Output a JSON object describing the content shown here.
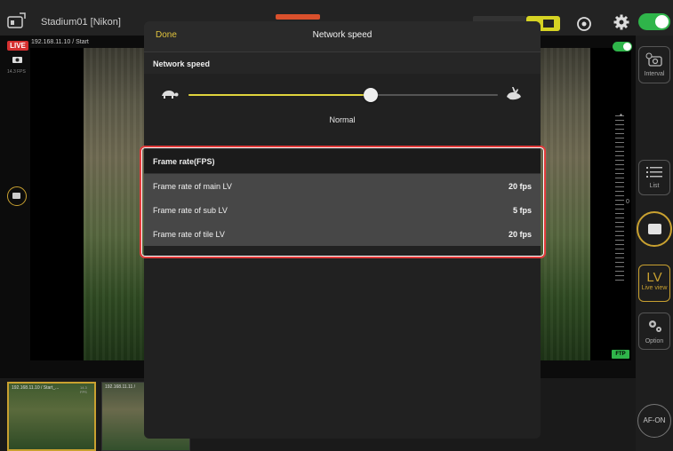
{
  "app": {
    "title": "Stadium01 [Nikon]"
  },
  "left_panel": {
    "live_badge": "LIVE",
    "ip_label": "192.168.11.10 / Start",
    "fps_label": "14.3 FPS"
  },
  "sidebar": {
    "interval_label": "Interval",
    "list_label": "List",
    "lv_text": "LV",
    "lv_label": "Live view",
    "option_label": "Option",
    "af_on_label": "AF-ON"
  },
  "overlay": {
    "ftp_badge": "FTP"
  },
  "thumbnails": [
    {
      "label": "192.168.11.10 / Start_...",
      "fps": "14.3 FPS"
    },
    {
      "label": "192.168.11.11 /",
      "fps": ""
    }
  ],
  "modal": {
    "done_label": "Done",
    "title": "Network speed",
    "network_section_label": "Network speed",
    "speed_value_label": "Normal",
    "speed_level": 0.59,
    "fps_section_label": "Frame rate(FPS)",
    "fps_rows": [
      {
        "name": "Frame rate of main LV",
        "value": "20 fps"
      },
      {
        "name": "Frame rate of sub LV",
        "value": "5 fps"
      },
      {
        "name": "Frame rate of tile LV",
        "value": "20 fps"
      }
    ]
  },
  "colors": {
    "accent": "#e0c33c",
    "highlight": "#e23b3b",
    "toggle_on": "#2fb54a",
    "live": "#d53030"
  }
}
